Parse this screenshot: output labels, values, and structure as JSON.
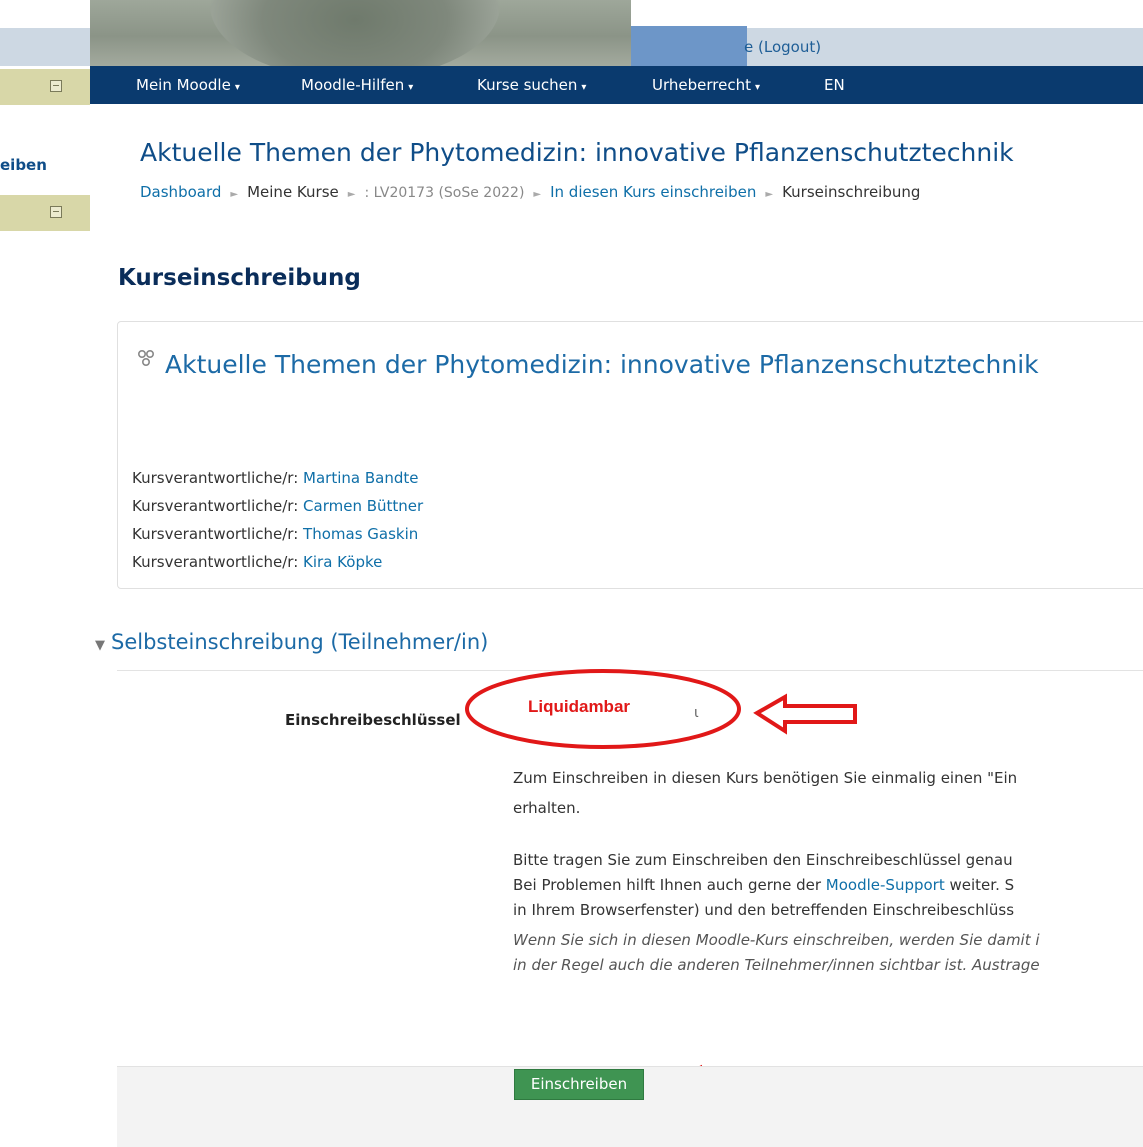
{
  "header": {
    "user_link": "e (Logout)",
    "nav": [
      {
        "label": "Mein Moodle",
        "caret": "▾"
      },
      {
        "label": "Moodle-Hilfen",
        "caret": "▾"
      },
      {
        "label": "Kurse suchen",
        "caret": "▾"
      },
      {
        "label": "Urheberrecht",
        "caret": "▾"
      },
      {
        "label": "EN",
        "caret": ""
      }
    ]
  },
  "sidebar": {
    "label": "eiben"
  },
  "page": {
    "title": "Aktuelle Themen der Phytomedizin: innovative Pflanzenschutztechnik",
    "breadcrumb": [
      "Dashboard",
      "Meine Kurse",
      ": LV20173 (SoSe 2022)",
      "In diesen Kurs einschreiben",
      "Kurseinschreibung"
    ],
    "breadcrumb_sep": "►",
    "heading": "Kurseinschreibung"
  },
  "course": {
    "name": "Aktuelle Themen der Phytomedizin: innovative Pflanzenschutztechnik",
    "teacher_role": "Kursverantwortliche/r:",
    "teachers": [
      "Martina Bandte",
      "Carmen Büttner",
      "Thomas Gaskin",
      "Kira Köpke"
    ]
  },
  "enrol": {
    "section_title": "Selbsteinschreibung (Teilnehmer/in)",
    "section_toggle": "▼",
    "key_label": "Einschreibeschlüssel",
    "key_value": "Liquidambar",
    "cursor_char": "ι",
    "para1_line1": "Zum Einschreiben in diesen Kurs benötigen Sie einmalig einen \"Ein",
    "para1_line2": "erhalten.",
    "para2_line1": "Bitte tragen Sie zum Einschreiben den Einschreibeschlüssel genau",
    "para2_line2_prefix": "Bei Problemen hilft Ihnen auch gerne der ",
    "para2_link": "Moodle-Support",
    "para2_line2_suffix": " weiter. S",
    "para2_line3": "in Ihrem Browserfenster) und den betreffenden Einschreibeschlüss",
    "note_line1": "Wenn Sie sich in diesen Moodle-Kurs einschreiben, werden Sie damit i",
    "note_line2": "in der Regel auch die anderen Teilnehmer/innen sichtbar ist. Austrage",
    "button_label": "Einschreiben"
  },
  "colors": {
    "nav_bg": "#0a3a6e",
    "link": "#0f6fa8",
    "button_bg": "#3f9452",
    "annotation_red": "#e11818"
  }
}
